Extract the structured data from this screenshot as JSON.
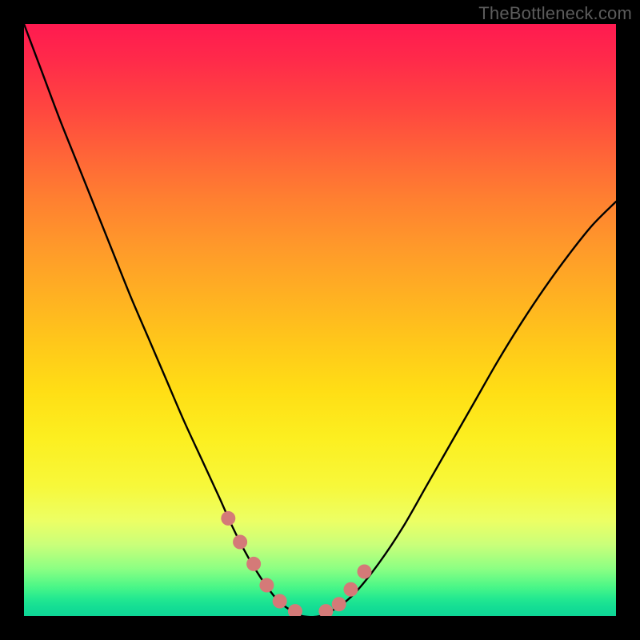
{
  "attribution": "TheBottleneck.com",
  "chart_data": {
    "type": "line",
    "title": "",
    "xlabel": "",
    "ylabel": "",
    "xlim": [
      0,
      100
    ],
    "ylim": [
      0,
      100
    ],
    "series": [
      {
        "name": "bottleneck-curve",
        "x": [
          0,
          3,
          6,
          9,
          12,
          15,
          18,
          21,
          24,
          27,
          30,
          33,
          35,
          37,
          39,
          41,
          43,
          45,
          47,
          50,
          53,
          56,
          60,
          64,
          68,
          72,
          76,
          80,
          84,
          88,
          92,
          96,
          100
        ],
        "values": [
          100,
          92,
          84,
          76.5,
          69,
          61.5,
          54,
          47,
          40,
          33,
          26.5,
          20,
          15.5,
          11.5,
          8,
          5,
          2.5,
          1,
          0,
          0,
          1.5,
          4,
          9,
          15,
          22,
          29,
          36,
          43,
          49.5,
          55.5,
          61,
          66,
          70
        ]
      }
    ],
    "markers": {
      "name": "highlight-markers",
      "x": [
        34.5,
        36.5,
        38.8,
        41.0,
        43.2,
        45.8,
        51.0,
        53.2,
        55.2,
        57.5
      ],
      "values": [
        16.5,
        12.5,
        8.8,
        5.2,
        2.5,
        0.8,
        0.8,
        2.0,
        4.5,
        7.5
      ],
      "color": "#d47a78",
      "radius": 9
    }
  }
}
